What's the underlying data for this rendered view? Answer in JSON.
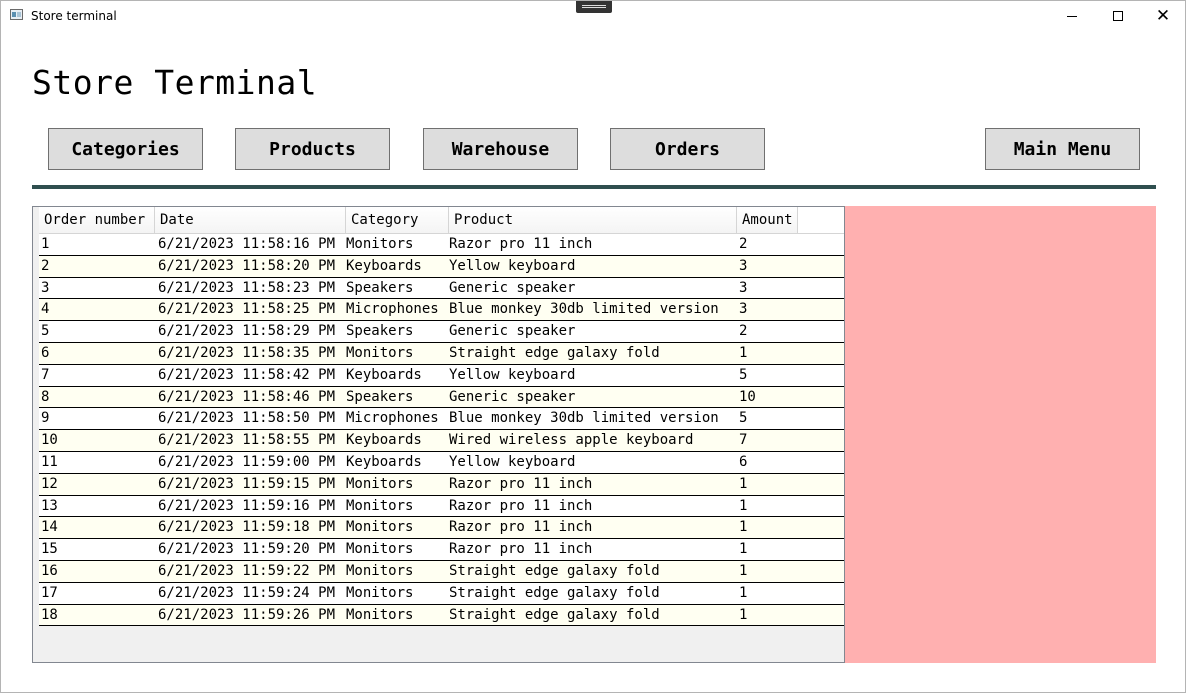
{
  "window": {
    "title": "Store terminal"
  },
  "page": {
    "heading": "Store Terminal"
  },
  "nav": {
    "categories": "Categories",
    "products": "Products",
    "warehouse": "Warehouse",
    "orders": "Orders",
    "main_menu": "Main Menu"
  },
  "colors": {
    "divider": "#2f4f4f",
    "side_panel": "#ffb0b0",
    "row_alt": "#fffff2"
  },
  "orders_table": {
    "columns": [
      "Order number",
      "Date",
      "Category",
      "Product",
      "Amount"
    ],
    "rows": [
      [
        "1",
        "6/21/2023 11:58:16 PM",
        "Monitors",
        "Razor pro 11 inch",
        "2"
      ],
      [
        "2",
        "6/21/2023 11:58:20 PM",
        "Keyboards",
        "Yellow keyboard",
        "3"
      ],
      [
        "3",
        "6/21/2023 11:58:23 PM",
        "Speakers",
        "Generic speaker",
        "3"
      ],
      [
        "4",
        "6/21/2023 11:58:25 PM",
        "Microphones",
        "Blue monkey 30db limited version",
        "3"
      ],
      [
        "5",
        "6/21/2023 11:58:29 PM",
        "Speakers",
        "Generic speaker",
        "2"
      ],
      [
        "6",
        "6/21/2023 11:58:35 PM",
        "Monitors",
        "Straight edge galaxy fold",
        "1"
      ],
      [
        "7",
        "6/21/2023 11:58:42 PM",
        "Keyboards",
        "Yellow keyboard",
        "5"
      ],
      [
        "8",
        "6/21/2023 11:58:46 PM",
        "Speakers",
        "Generic speaker",
        "10"
      ],
      [
        "9",
        "6/21/2023 11:58:50 PM",
        "Microphones",
        "Blue monkey 30db limited version",
        "5"
      ],
      [
        "10",
        "6/21/2023 11:58:55 PM",
        "Keyboards",
        "Wired wireless apple keyboard",
        "7"
      ],
      [
        "11",
        "6/21/2023 11:59:00 PM",
        "Keyboards",
        "Yellow keyboard",
        "6"
      ],
      [
        "12",
        "6/21/2023 11:59:15 PM",
        "Monitors",
        "Razor pro 11 inch",
        "1"
      ],
      [
        "13",
        "6/21/2023 11:59:16 PM",
        "Monitors",
        "Razor pro 11 inch",
        "1"
      ],
      [
        "14",
        "6/21/2023 11:59:18 PM",
        "Monitors",
        "Razor pro 11 inch",
        "1"
      ],
      [
        "15",
        "6/21/2023 11:59:20 PM",
        "Monitors",
        "Razor pro 11 inch",
        "1"
      ],
      [
        "16",
        "6/21/2023 11:59:22 PM",
        "Monitors",
        "Straight edge galaxy fold",
        "1"
      ],
      [
        "17",
        "6/21/2023 11:59:24 PM",
        "Monitors",
        "Straight edge galaxy fold",
        "1"
      ],
      [
        "18",
        "6/21/2023 11:59:26 PM",
        "Monitors",
        "Straight edge galaxy fold",
        "1"
      ]
    ]
  }
}
